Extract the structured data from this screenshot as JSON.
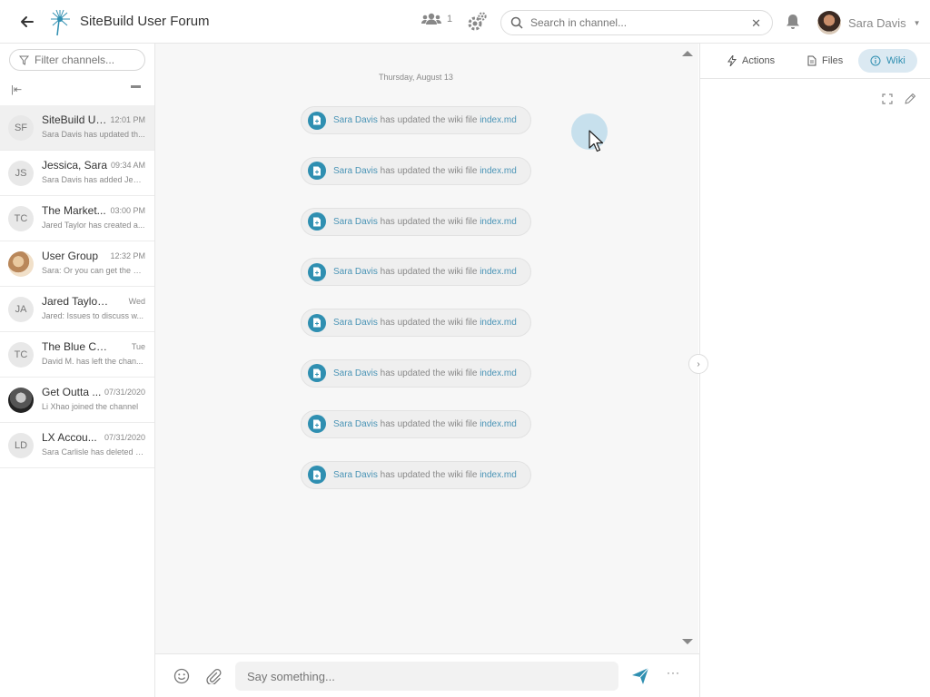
{
  "header": {
    "title": "SiteBuild User Forum",
    "member_count": "1",
    "search_placeholder": "Search in channel...",
    "user_name": "Sara Davis"
  },
  "sidebar": {
    "filter_placeholder": "Filter channels...",
    "channels": [
      {
        "initials": "SF",
        "name": "SiteBuild Us...",
        "time": "12:01 PM",
        "preview": "Sara Davis has updated th...",
        "active": true
      },
      {
        "initials": "JS",
        "name": "Jessica, Sara",
        "time": "09:34 AM",
        "preview": "Sara Davis has added Jess..."
      },
      {
        "initials": "TC",
        "name": "The Market...",
        "time": "03:00 PM",
        "preview": "Jared Taylor has created a..."
      },
      {
        "initials": "",
        "name": "User Group",
        "time": "12:32 PM",
        "preview": "Sara: Or you can get the pr..."
      },
      {
        "initials": "JA",
        "name": "Jared Taylor ac...",
        "time": "Wed",
        "preview": "Jared: Issues to discuss w..."
      },
      {
        "initials": "TC",
        "name": "The Blue Carrot ...",
        "time": "Tue",
        "preview": "David M. has left the chan..."
      },
      {
        "initials": "",
        "name": "Get Outta ...",
        "time": "07/31/2020",
        "preview": "Li Xhao joined the channel"
      },
      {
        "initials": "LD",
        "name": "LX Accou...",
        "time": "07/31/2020",
        "preview": "Sara Carlisle has deleted a..."
      }
    ]
  },
  "chat": {
    "date_separator": "Thursday, August 13",
    "messages": [
      {
        "author": "Sara Davis",
        "action": " has updated the wiki file ",
        "file": "index.md"
      },
      {
        "author": "Sara Davis",
        "action": " has updated the wiki file ",
        "file": "index.md"
      },
      {
        "author": "Sara Davis",
        "action": " has updated the wiki file ",
        "file": "index.md"
      },
      {
        "author": "Sara Davis",
        "action": " has updated the wiki file ",
        "file": "index.md"
      },
      {
        "author": "Sara Davis",
        "action": " has updated the wiki file ",
        "file": "index.md"
      },
      {
        "author": "Sara Davis",
        "action": " has updated the wiki file ",
        "file": "index.md"
      },
      {
        "author": "Sara Davis",
        "action": " has updated the wiki file ",
        "file": "index.md"
      },
      {
        "author": "Sara Davis",
        "action": " has updated the wiki file ",
        "file": "index.md"
      }
    ],
    "composer_placeholder": "Say something...",
    "more_label": "···"
  },
  "right_panel": {
    "tabs": [
      {
        "label": "Actions",
        "icon": "bolt-icon"
      },
      {
        "label": "Files",
        "icon": "file-icon"
      },
      {
        "label": "Wiki",
        "icon": "info-icon",
        "active": true
      }
    ]
  },
  "colors": {
    "accent": "#2f8fb1",
    "link": "#4a94b6",
    "active_tab_bg": "#dbe9f2"
  }
}
